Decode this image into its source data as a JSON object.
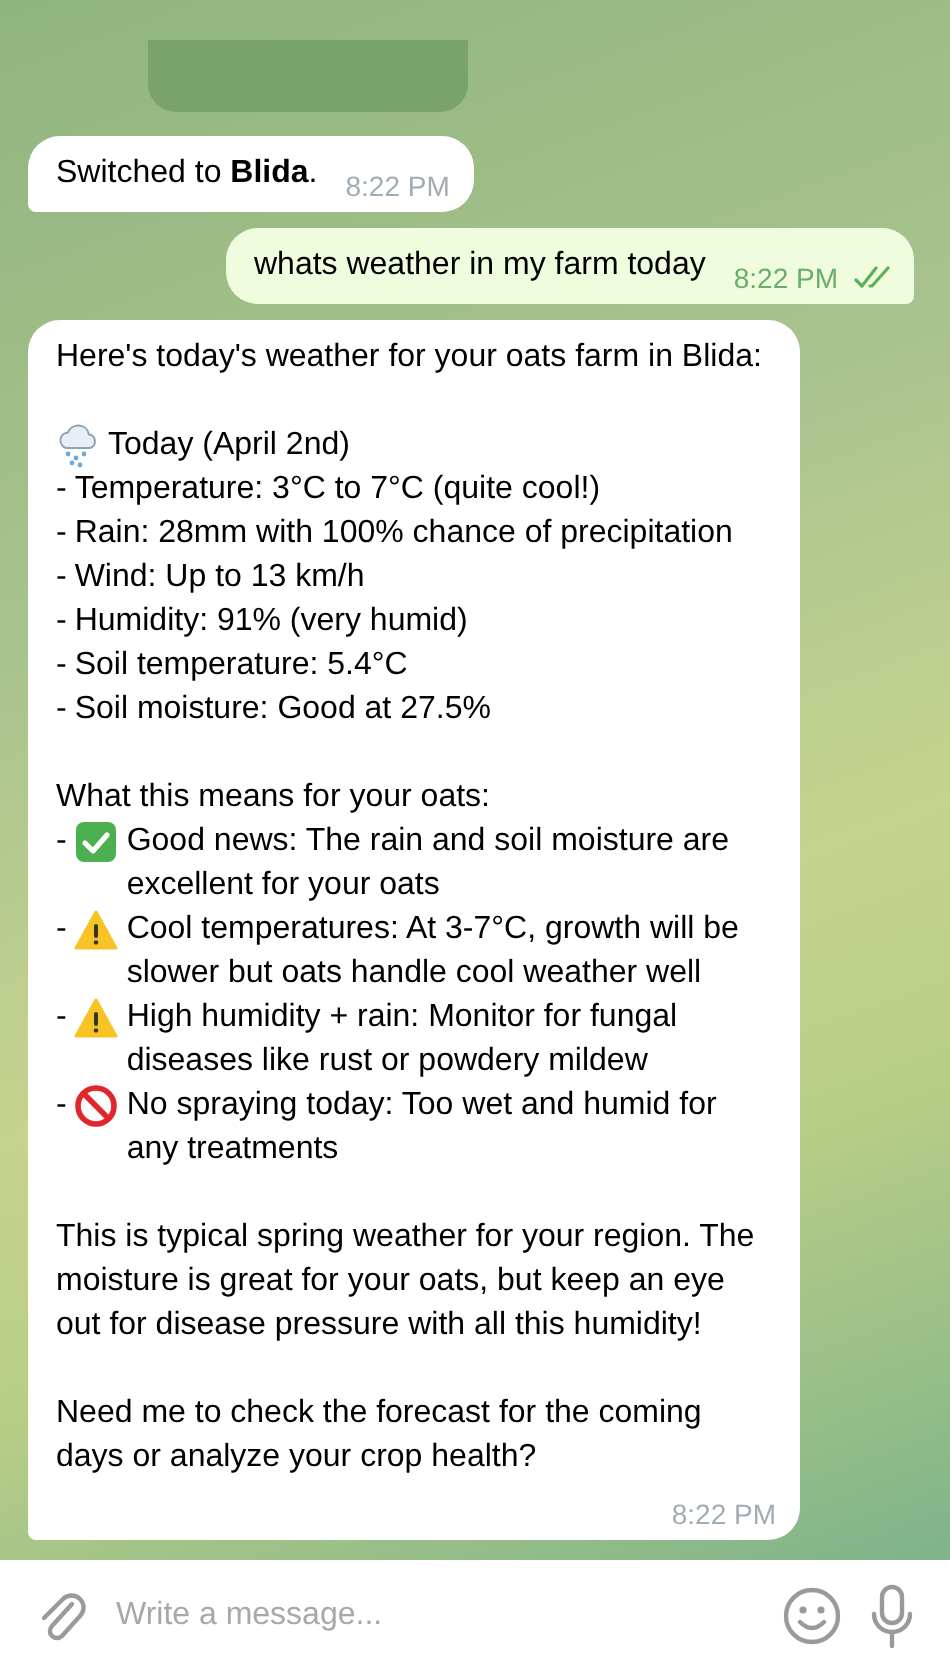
{
  "messages": [
    {
      "kind": "incoming",
      "blocks": [
        [
          {
            "text": "Switched to **Blida**."
          }
        ]
      ],
      "time": "8:22 PM"
    },
    {
      "kind": "outgoing",
      "blocks": [
        [
          {
            "text": "whats weather in my farm today"
          }
        ]
      ],
      "time": "8:22 PM",
      "read": true
    },
    {
      "kind": "incoming",
      "blocks": [
        [
          {
            "text": "Here's today's weather for your oats farm in Blida:"
          }
        ],
        [
          {
            "kind": "snow",
            "text": "Today (April 2nd)"
          },
          {
            "prefix": "-",
            "text": "Temperature: 3°C to 7°C (quite cool!)"
          },
          {
            "prefix": "-",
            "text": "Rain: 28mm with 100% chance of precipitation"
          },
          {
            "prefix": "-",
            "text": "Wind: Up to 13 km/h"
          },
          {
            "prefix": "-",
            "text": "Humidity: 91% (very humid)"
          },
          {
            "prefix": "-",
            "text": "Soil temperature: 5.4°C"
          },
          {
            "prefix": "-",
            "text": "Soil moisture: Good at 27.5%"
          }
        ],
        [
          {
            "text": "What this means for your oats:"
          },
          {
            "prefix": "-",
            "kind": "good",
            "text": "Good news: The rain and soil moisture are excellent for your oats"
          },
          {
            "prefix": "-",
            "kind": "caution",
            "text": "Cool temperatures: At 3-7°C, growth will be slower but oats handle cool weather well"
          },
          {
            "prefix": "-",
            "kind": "caution",
            "text": "High humidity + rain: Monitor for fungal diseases like rust or powdery mildew"
          },
          {
            "prefix": "-",
            "kind": "forbidden",
            "text": "No spraying today: Too wet and humid for any treatments"
          }
        ],
        [
          {
            "text": "This is typical spring weather for your region. The moisture is great for your oats, but keep an eye out for disease pressure with all this humidity!"
          }
        ],
        [
          {
            "text": "Need me to check the forecast for the coming days or analyze your crop health?"
          }
        ]
      ],
      "time": "8:22 PM"
    }
  ],
  "composer": {
    "placeholder": "Write a message..."
  }
}
